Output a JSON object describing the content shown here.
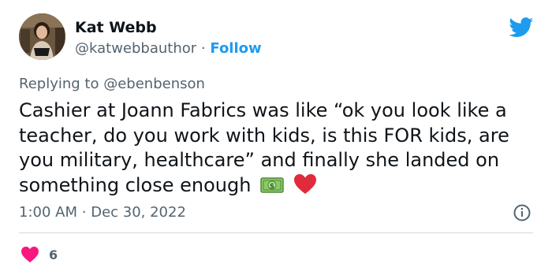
{
  "author": {
    "name": "Kat Webb",
    "handle": "@katwebbauthor",
    "separator": "·",
    "follow_label": "Follow"
  },
  "reply": {
    "prefix": "Replying to",
    "mention": "@ebenbenson"
  },
  "tweet": {
    "text": "Cashier at Joann Fabrics was like “ok you look like a teacher, do you work with kids, is this FOR kids, are you military, healthcare” and finally she landed on something close enough",
    "emojis": [
      "money-icon",
      "red-heart-icon"
    ]
  },
  "meta": {
    "time": "1:00 AM",
    "separator": "·",
    "date": "Dec 30, 2022"
  },
  "likes": {
    "count": "6"
  },
  "colors": {
    "brand_blue": "#1d9bf0",
    "like_pink": "#f91880",
    "secondary_text": "#536471",
    "divider": "#cfd9de"
  }
}
